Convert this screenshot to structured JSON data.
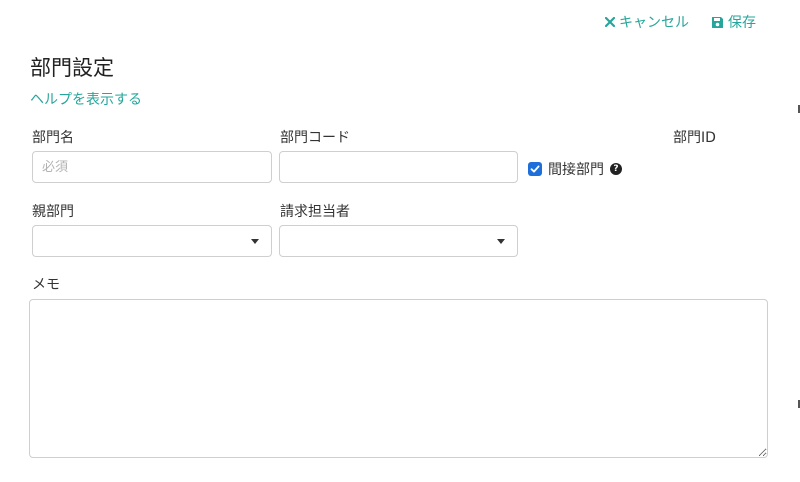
{
  "toolbar": {
    "cancel_label": "キャンセル",
    "save_label": "保存",
    "accent_color": "#26a69a"
  },
  "page": {
    "title": "部門設定",
    "help_link": "ヘルプを表示する"
  },
  "form": {
    "department_name": {
      "label": "部門名",
      "placeholder": "必須",
      "value": ""
    },
    "department_code": {
      "label": "部門コード",
      "value": ""
    },
    "indirect": {
      "label": "間接部門",
      "checked": true
    },
    "department_id": {
      "label": "部門ID"
    },
    "parent_department": {
      "label": "親部門",
      "selected": ""
    },
    "billing_contact": {
      "label": "請求担当者",
      "selected": ""
    },
    "memo": {
      "label": "メモ",
      "value": ""
    }
  },
  "icons": {
    "cancel": "times-icon",
    "save": "floppy-disk-icon",
    "help": "question-circle-icon",
    "dropdown": "caret-down-icon"
  }
}
